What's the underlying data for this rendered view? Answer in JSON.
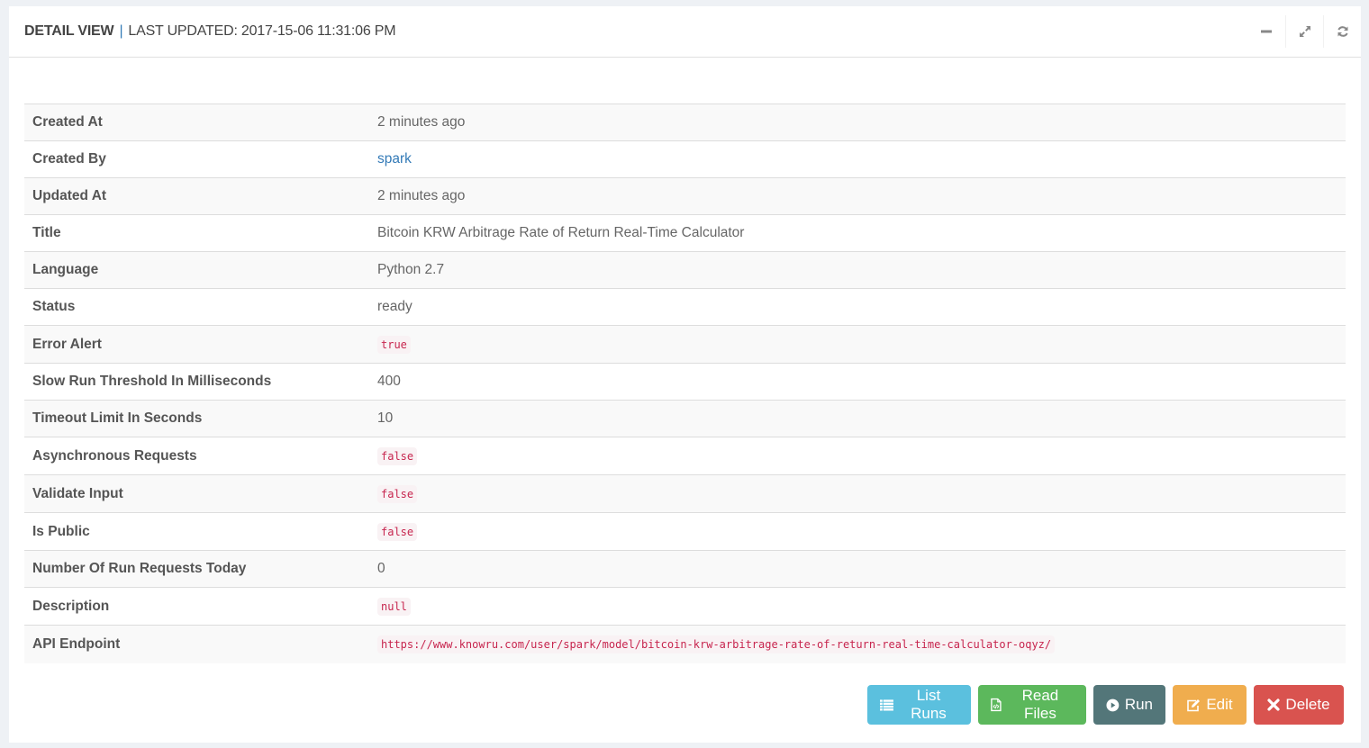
{
  "header": {
    "title": "DETAIL VIEW",
    "separator": "|",
    "last_updated_label": "LAST UPDATED: 2017-15-06 11:31:06 PM",
    "tools": [
      {
        "icon": "minus-icon",
        "label": "Collapse"
      },
      {
        "icon": "expand-icon",
        "label": "Fullscreen"
      },
      {
        "icon": "refresh-icon",
        "label": "Reload"
      }
    ]
  },
  "details": [
    {
      "key": "Created At",
      "value": "2 minutes ago",
      "type": "text"
    },
    {
      "key": "Created By",
      "value": "spark",
      "type": "link"
    },
    {
      "key": "Updated At",
      "value": "2 minutes ago",
      "type": "text"
    },
    {
      "key": "Title",
      "value": "Bitcoin KRW Arbitrage Rate of Return Real-Time Calculator",
      "type": "text"
    },
    {
      "key": "Language",
      "value": "Python 2.7",
      "type": "text"
    },
    {
      "key": "Status",
      "value": "ready",
      "type": "text"
    },
    {
      "key": "Error Alert",
      "value": "true",
      "type": "code"
    },
    {
      "key": "Slow Run Threshold In Milliseconds",
      "value": "400",
      "type": "text"
    },
    {
      "key": "Timeout Limit In Seconds",
      "value": "10",
      "type": "text"
    },
    {
      "key": "Asynchronous Requests",
      "value": "false",
      "type": "code"
    },
    {
      "key": "Validate Input",
      "value": "false",
      "type": "code"
    },
    {
      "key": "Is Public",
      "value": "false",
      "type": "code"
    },
    {
      "key": "Number Of Run Requests Today",
      "value": "0",
      "type": "text"
    },
    {
      "key": "Description",
      "value": "null",
      "type": "code"
    },
    {
      "key": "API Endpoint",
      "value": "https://www.knowru.com/user/spark/model/bitcoin-krw-arbitrage-rate-of-return-real-time-calculator-oqyz/",
      "type": "code"
    }
  ],
  "actions": {
    "list_runs": {
      "label": "List Runs",
      "icon": "list-icon",
      "color": "#5bc0de"
    },
    "read_files": {
      "label": "Read Files",
      "icon": "code-file-icon",
      "color": "#5cb85c"
    },
    "run": {
      "label": "Run",
      "icon": "play-circle-icon",
      "color": "#537679"
    },
    "edit": {
      "label": "Edit",
      "icon": "edit-icon",
      "color": "#f0ad4e"
    },
    "delete": {
      "label": "Delete",
      "icon": "times-icon",
      "color": "#d9534f"
    }
  }
}
